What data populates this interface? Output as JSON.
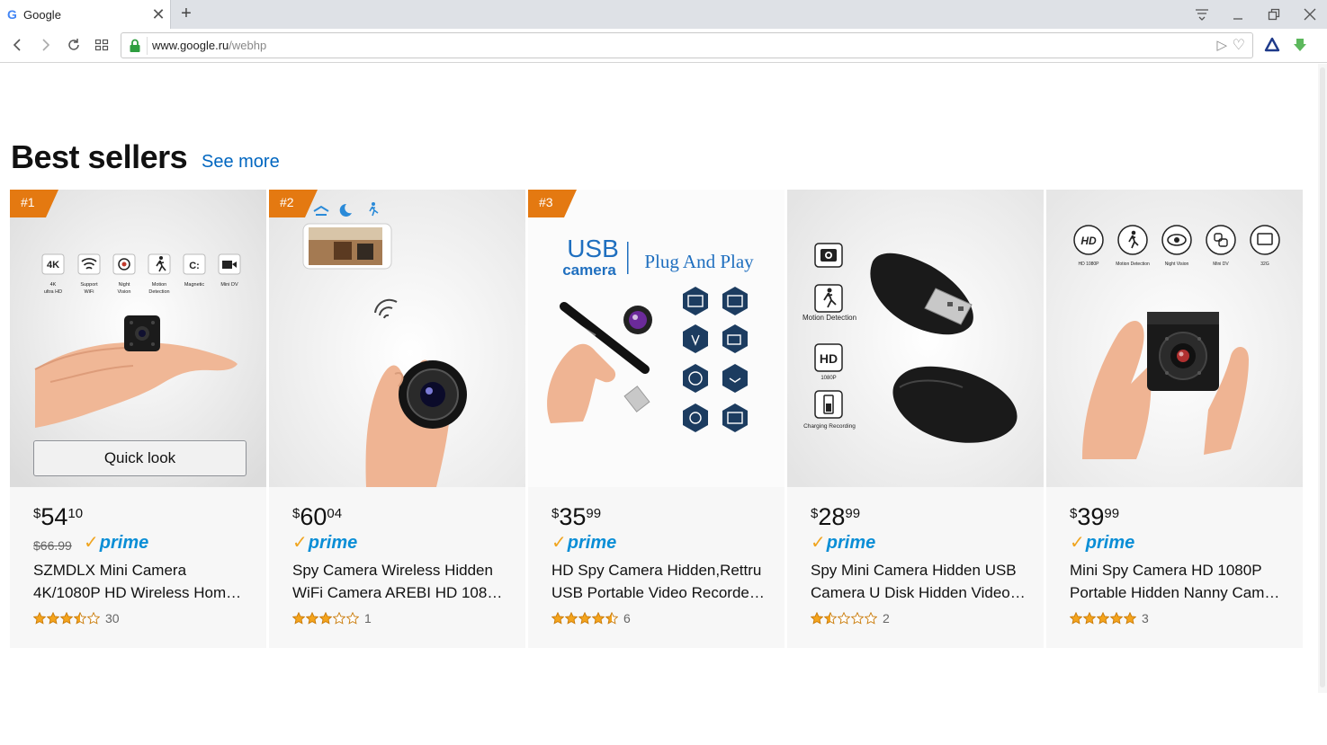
{
  "browser": {
    "tab_title": "Google",
    "tab_favicon": "G",
    "url_host": "www.google.ru",
    "url_path": "/webhp"
  },
  "page": {
    "heading": "Best sellers",
    "see_more": "See more",
    "quick_look": "Quick look",
    "accent_color": "#e47911",
    "link_color": "#0066c0",
    "prime_color": "#0a8ed6"
  },
  "products": [
    {
      "rank": "#1",
      "currency": "$",
      "price_whole": "54",
      "price_fraction": "10",
      "list_price": "$66.99",
      "prime_label": "prime",
      "title_line1": "SZMDLX Mini Camera",
      "title_line2": "4K/1080P HD Wireless Hom…",
      "rating": 3.5,
      "review_count": "30",
      "image_labels": [
        "4K",
        "4K ultra HD",
        "Support WiFi",
        "Night Vision",
        "Motion Detection",
        "Magnetic",
        "Mini DV"
      ]
    },
    {
      "rank": "#2",
      "currency": "$",
      "price_whole": "60",
      "price_fraction": "04",
      "prime_label": "prime",
      "title_line1": "Spy Camera Wireless Hidden",
      "title_line2": "WiFi Camera AREBI HD 1080…",
      "rating": 3,
      "review_count": "1"
    },
    {
      "rank": "#3",
      "currency": "$",
      "price_whole": "35",
      "price_fraction": "99",
      "prime_label": "prime",
      "title_line1": "HD Spy Camera Hidden,Rettru",
      "title_line2": "USB Portable Video Recorde…",
      "rating": 4.5,
      "review_count": "6",
      "image_labels": [
        "USB",
        "camera",
        "Plug And Play"
      ]
    },
    {
      "currency": "$",
      "price_whole": "28",
      "price_fraction": "99",
      "prime_label": "prime",
      "title_line1": "Spy Mini Camera Hidden USB",
      "title_line2": "Camera U Disk Hidden Video…",
      "rating": 1.5,
      "review_count": "2",
      "image_labels": [
        "Motion Detection",
        "HD",
        "1080P",
        "Charging Recording"
      ]
    },
    {
      "currency": "$",
      "price_whole": "39",
      "price_fraction": "99",
      "prime_label": "prime",
      "title_line1": "Mini Spy Camera HD 1080P",
      "title_line2": "Portable Hidden Nanny Cam…",
      "rating": 5,
      "review_count": "3",
      "image_labels": [
        "HD",
        "HD 1080P",
        "Motion Detection",
        "Night Vision",
        "Mini DV",
        "32G"
      ]
    }
  ]
}
